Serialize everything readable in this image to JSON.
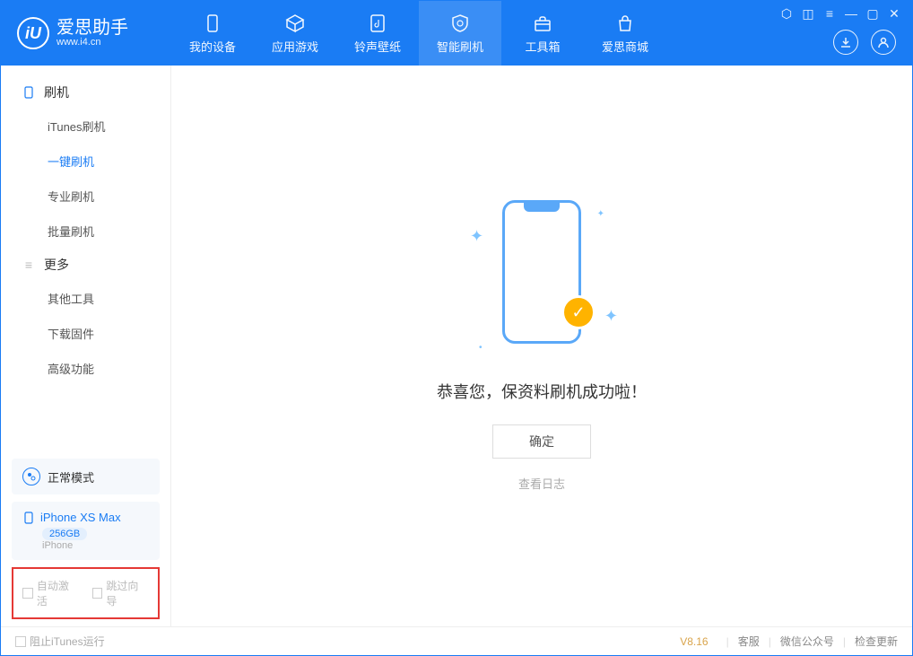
{
  "app": {
    "title": "爱思助手",
    "subtitle": "www.i4.cn"
  },
  "window_controls": {
    "feedback": "⬡",
    "skin": "◫",
    "menu": "≡",
    "min": "—",
    "max": "▢",
    "close": "✕"
  },
  "nav": {
    "device": "我的设备",
    "apps": "应用游戏",
    "ringtone": "铃声壁纸",
    "flash": "智能刷机",
    "toolbox": "工具箱",
    "store": "爱思商城"
  },
  "sidebar": {
    "section_flash": "刷机",
    "items_flash": [
      "iTunes刷机",
      "一键刷机",
      "专业刷机",
      "批量刷机"
    ],
    "section_more": "更多",
    "items_more": [
      "其他工具",
      "下载固件",
      "高级功能"
    ]
  },
  "status": {
    "mode": "正常模式"
  },
  "device": {
    "name": "iPhone XS Max",
    "capacity": "256GB",
    "type": "iPhone"
  },
  "flags": {
    "auto_activate": "自动激活",
    "skip_guide": "跳过向导"
  },
  "main": {
    "success_msg": "恭喜您，保资料刷机成功啦！",
    "ok": "确定",
    "view_log": "查看日志"
  },
  "footer": {
    "block_itunes": "阻止iTunes运行",
    "version": "V8.16",
    "support": "客服",
    "wechat": "微信公众号",
    "update": "检查更新"
  }
}
